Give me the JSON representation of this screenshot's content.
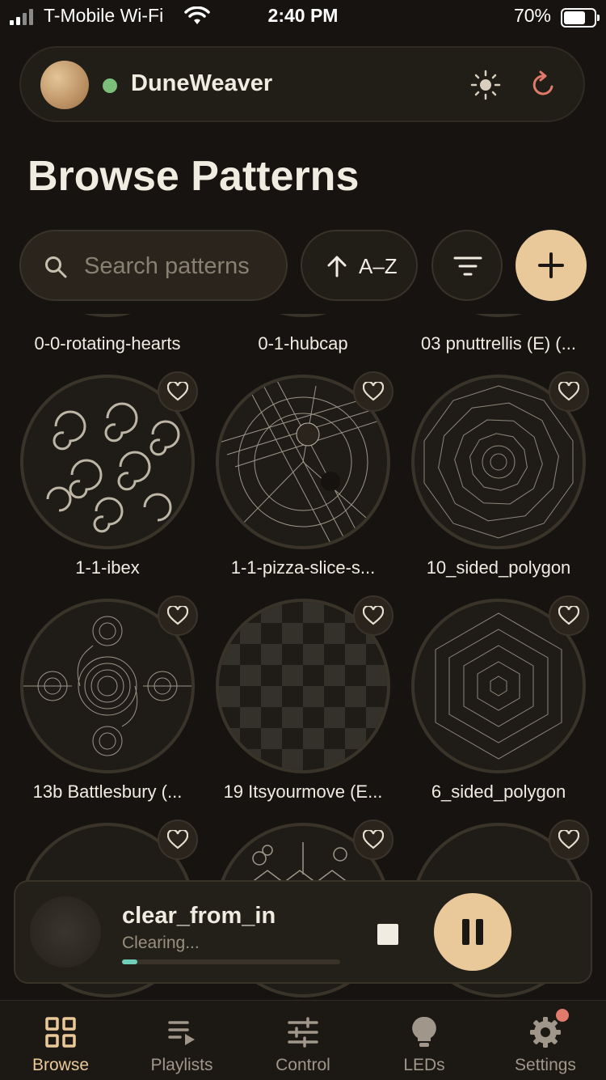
{
  "status_bar": {
    "carrier": "T-Mobile Wi-Fi",
    "time": "2:40 PM",
    "battery": "70%"
  },
  "header": {
    "device_name": "DuneWeaver",
    "status_color": "#7bbf7a",
    "icons": [
      "sun-icon",
      "refresh-icon"
    ]
  },
  "page": {
    "title": "Browse Patterns"
  },
  "toolbar": {
    "search_placeholder": "Search patterns",
    "sort_label": "A–Z"
  },
  "patterns": [
    {
      "name": "0-0-rotating-hearts"
    },
    {
      "name": "0-1-hubcap"
    },
    {
      "name": "03 pnuttrellis (E) (..."
    },
    {
      "name": "1-1-ibex"
    },
    {
      "name": "1-1-pizza-slice-s..."
    },
    {
      "name": "10_sided_polygon"
    },
    {
      "name": "13b Battlesbury (..."
    },
    {
      "name": "19 Itsyourmove (E..."
    },
    {
      "name": "6_sided_polygon"
    },
    {
      "name": ""
    },
    {
      "name": ""
    },
    {
      "name": ""
    }
  ],
  "now_playing": {
    "title": "clear_from_in",
    "status": "Clearing...",
    "progress": 0.07
  },
  "tabs": [
    {
      "label": "Browse",
      "icon": "grid-icon",
      "active": true
    },
    {
      "label": "Playlists",
      "icon": "playlist-icon"
    },
    {
      "label": "Control",
      "icon": "sliders-icon"
    },
    {
      "label": "LEDs",
      "icon": "bulb-icon"
    },
    {
      "label": "Settings",
      "icon": "gear-icon",
      "badge": true
    }
  ],
  "colors": {
    "accent": "#e9c89a",
    "background": "#161310",
    "progress": "#6fd0b9",
    "badge": "#e07a6a"
  }
}
